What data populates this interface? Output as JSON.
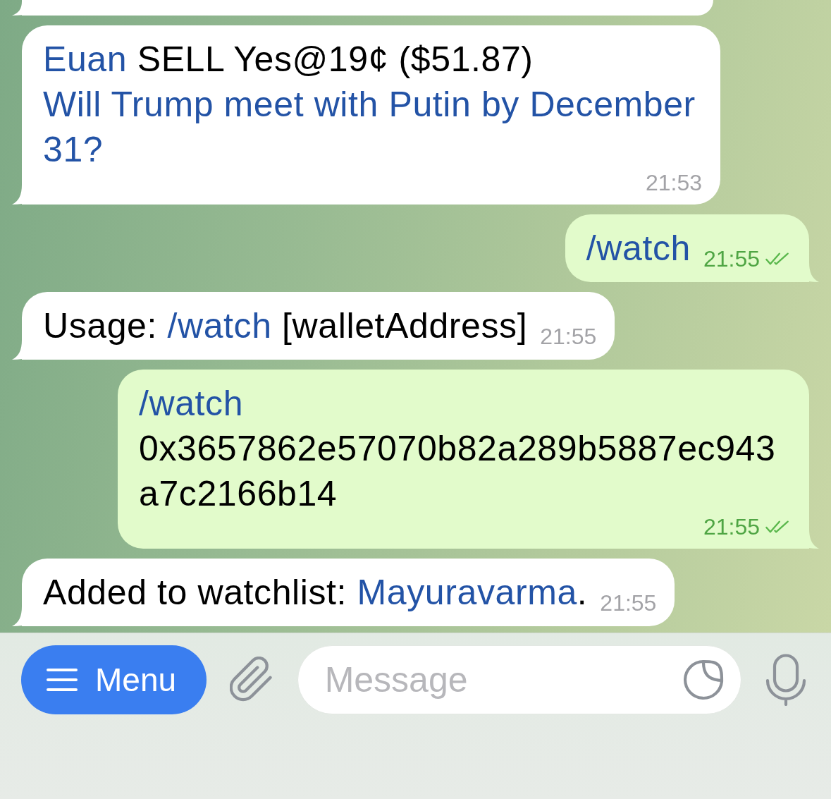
{
  "chat": {
    "messages": [
      {
        "kind": "incoming",
        "clipped": true
      },
      {
        "kind": "incoming",
        "lines": [
          [
            {
              "kind": "link",
              "text": "Euan"
            },
            {
              "kind": "text",
              "text": " SELL Yes@19¢ ($51.87)"
            }
          ],
          [
            {
              "kind": "link",
              "text": "Will Trump meet with Putin by December 31?"
            }
          ]
        ],
        "time": "21:53"
      },
      {
        "kind": "outgoing",
        "lines": [
          [
            {
              "kind": "link",
              "text": "/watch"
            }
          ]
        ],
        "time": "21:55",
        "read": true
      },
      {
        "kind": "incoming",
        "lines": [
          [
            {
              "kind": "text",
              "text": "Usage: "
            },
            {
              "kind": "link",
              "text": "/watch"
            },
            {
              "kind": "text",
              "text": " [walletAddress]"
            }
          ]
        ],
        "time": "21:55"
      },
      {
        "kind": "outgoing",
        "lines": [
          [
            {
              "kind": "link",
              "text": "/watch"
            },
            {
              "kind": "text",
              "text": " 0x3657862e57070b82a289b5887ec943a7c2166b14"
            }
          ]
        ],
        "time": "21:55",
        "read": true
      },
      {
        "kind": "incoming",
        "lines": [
          [
            {
              "kind": "text",
              "text": "Added to watchlist: "
            },
            {
              "kind": "link",
              "text": "Mayuravarma"
            },
            {
              "kind": "text",
              "text": "."
            }
          ]
        ],
        "time": "21:55"
      }
    ]
  },
  "composer": {
    "menu_button": "Menu",
    "placeholder": "Message"
  }
}
